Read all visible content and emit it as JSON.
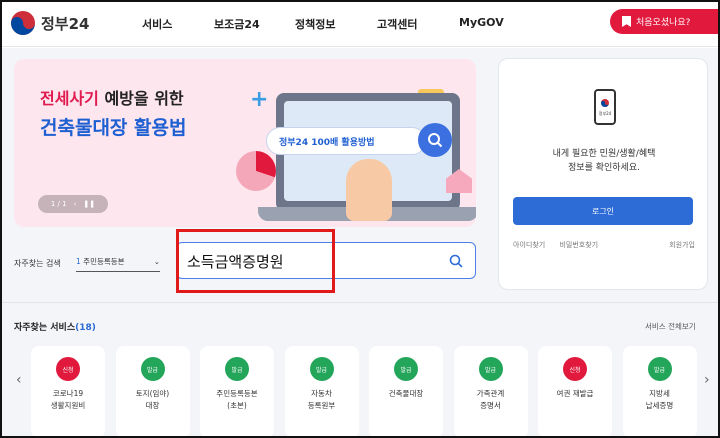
{
  "header": {
    "logo_text": "정부24",
    "nav": [
      "서비스",
      "보조금24",
      "정책정보",
      "고객센터",
      "MyGOV"
    ],
    "first_visit_label": "처음오셨나요?"
  },
  "banner": {
    "title_red": "전세사기",
    "title_rest": " 예방을 위한",
    "title_blue": "건축물대장 활용법",
    "search_text": "정부24 100배 활용방법",
    "pager": {
      "current": "1",
      "total": "1"
    }
  },
  "login_card": {
    "app_label": "정부24",
    "message": "내게 필요한 민원/생활/혜택\n정보를 확인하세요.",
    "login_label": "로그인",
    "find_id": "아이디찾기",
    "find_pw": "비밀번호찾기",
    "signup": "회원가입"
  },
  "search": {
    "freq_label": "자주찾는 검색",
    "freq_num": "1",
    "freq_value": "주민등록등본",
    "query": "소득금액증명원"
  },
  "services": {
    "title": "자주찾는 서비스",
    "count": "(18)",
    "view_all": "서비스 전체보기",
    "items": [
      {
        "badge": "신청",
        "label": "코로나19\n생활지원비",
        "color": "#e0193d"
      },
      {
        "badge": "발급",
        "label": "토지(임야)\n대장",
        "color": "#23a55a"
      },
      {
        "badge": "발급",
        "label": "주민등록등본\n(초본)",
        "color": "#23a55a"
      },
      {
        "badge": "발급",
        "label": "자동차\n등록원부",
        "color": "#23a55a"
      },
      {
        "badge": "발급",
        "label": "건축물대장",
        "color": "#23a55a"
      },
      {
        "badge": "발급",
        "label": "가족관계\n증명서",
        "color": "#23a55a"
      },
      {
        "badge": "신청",
        "label": "여권 재발급",
        "color": "#e0193d"
      },
      {
        "badge": "발급",
        "label": "지방세\n납세증명",
        "color": "#23a55a"
      }
    ]
  }
}
